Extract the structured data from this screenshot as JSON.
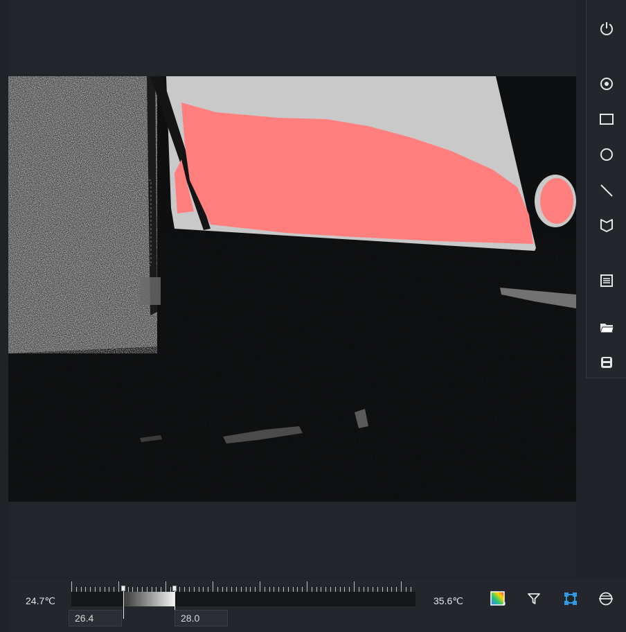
{
  "toolbar": {
    "tools": [
      {
        "icon": "power-icon"
      },
      {
        "icon": "spot-target-icon"
      },
      {
        "icon": "rectangle-icon"
      },
      {
        "icon": "circle-icon"
      },
      {
        "icon": "line-icon"
      },
      {
        "icon": "polygon-icon"
      },
      {
        "icon": "list-icon"
      },
      {
        "icon": "folder-icon"
      },
      {
        "icon": "save-icon"
      }
    ]
  },
  "scale": {
    "min_label": "24.7℃",
    "max_label": "35.6℃",
    "low_value": "26.4",
    "high_value": "28.0"
  },
  "bottom_tools": [
    {
      "icon": "palette-icon"
    },
    {
      "icon": "filter-icon"
    },
    {
      "icon": "region-select-icon"
    },
    {
      "icon": "isotherm-icon"
    }
  ],
  "colors": {
    "alarm_overlay": "#ff7f7f",
    "accent": "#2f9be6",
    "background": "#1f2227"
  }
}
